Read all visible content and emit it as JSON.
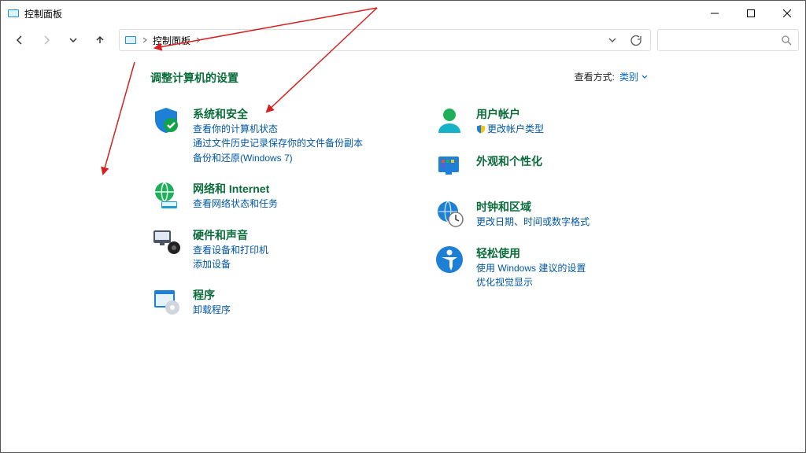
{
  "window": {
    "title": "控制面板"
  },
  "breadcrumb": {
    "root": "控制面板"
  },
  "page": {
    "heading": "调整计算机的设置",
    "view_label": "查看方式:",
    "view_value": "类别"
  },
  "left_column": [
    {
      "title": "系统和安全",
      "links": [
        {
          "text": "查看你的计算机状态",
          "shield": false
        },
        {
          "text": "通过文件历史记录保存你的文件备份副本",
          "shield": false
        },
        {
          "text": "备份和还原(Windows 7)",
          "shield": false
        }
      ]
    },
    {
      "title": "网络和 Internet",
      "links": [
        {
          "text": "查看网络状态和任务",
          "shield": false
        }
      ]
    },
    {
      "title": "硬件和声音",
      "links": [
        {
          "text": "查看设备和打印机",
          "shield": false
        },
        {
          "text": "添加设备",
          "shield": false
        }
      ]
    },
    {
      "title": "程序",
      "links": [
        {
          "text": "卸载程序",
          "shield": false
        }
      ]
    }
  ],
  "right_column": [
    {
      "title": "用户帐户",
      "links": [
        {
          "text": "更改帐户类型",
          "shield": true
        }
      ]
    },
    {
      "title": "外观和个性化",
      "links": []
    },
    {
      "title": "时钟和区域",
      "links": [
        {
          "text": "更改日期、时间或数字格式",
          "shield": false
        }
      ]
    },
    {
      "title": "轻松使用",
      "links": [
        {
          "text": "使用 Windows 建议的设置",
          "shield": false
        },
        {
          "text": "优化视觉显示",
          "shield": false
        }
      ]
    }
  ]
}
